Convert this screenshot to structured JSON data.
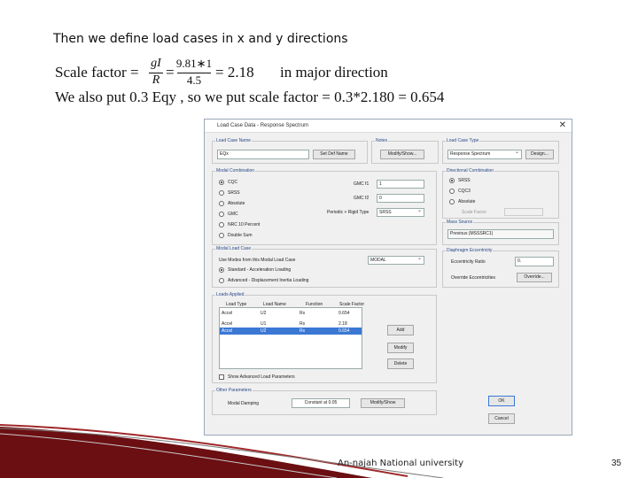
{
  "heading": "Then we define load cases in x and y directions",
  "equation1": {
    "lhs": "Scale factor =",
    "frac1_num": "gI",
    "frac1_den": "R",
    "eq_sign": "=",
    "frac2_num": "9.81∗1",
    "frac2_den": "4.5",
    "result": "= 2.18",
    "note": "in major direction"
  },
  "equation2": "We also put 0.3 Eqy , so we put scale factor = 0.3*2.180 = 0.654",
  "dialog": {
    "title": "Load Case Data - Response Spectrum",
    "close": "✕",
    "load_case_name_group": "Load Case Name",
    "load_case_name": "EQx",
    "set_def_name": "Set Def Name",
    "notes_group": "Notes",
    "modify_show": "Modify/Show...",
    "load_case_type_group": "Load Case Type",
    "load_case_type": "Response Spectrum",
    "design": "Design...",
    "modal_combination_group": "Modal Combination",
    "modal_options": [
      "CQC",
      "SRSS",
      "Absolute",
      "GMC",
      "NRC 10 Percent",
      "Double Sum"
    ],
    "gmc_f1_label": "GMC f1",
    "gmc_f1": "1",
    "gmc_f2_label": "GMC f2",
    "gmc_f2": "0",
    "periodic_rigid_label": "Periodic + Rigid Type",
    "periodic_rigid": "SRSS",
    "directional_combination_group": "Directional Combination",
    "directional_options": [
      "SRSS",
      "CQC3",
      "Absolute"
    ],
    "scale_factor_label": "Scale Factor",
    "mass_source_group": "Mass Source",
    "mass_source": "Previous (MSSSRC1)",
    "modal_load_case_group": "Modal Load Case",
    "use_modes_label": "Use Modes from this Modal Load Case",
    "modal_case": "MODAL",
    "loading_options": [
      "Standard - Acceleration Loading",
      "Advanced - Displacement Inertia Loading"
    ],
    "diaphragm_group": "Diaphragm Eccentricity",
    "eccentricity_ratio_label": "Eccentricity Ratio",
    "eccentricity_ratio": "0.",
    "override_label": "Override Eccentricities",
    "override_button": "Override...",
    "loads_applied_group": "Loads Applied",
    "table_headers": [
      "Load Type",
      "Load Name",
      "Function",
      "Scale Factor"
    ],
    "table_edit_row": [
      "Accel",
      "U2",
      "Rs",
      "0.654"
    ],
    "table_rows": [
      [
        "Accel",
        "U1",
        "Rs",
        "2.18"
      ],
      [
        "Accel",
        "U2",
        "Rs",
        "0.654"
      ]
    ],
    "add": "Add",
    "modify": "Modify",
    "delete": "Delete",
    "show_advanced": "Show Advanced Load Parameters",
    "other_parameters_group": "Other Parameters",
    "modal_damping_label": "Modal Damping",
    "modal_damping": "Constant at 0.05",
    "modify_show2": "Modify/Show",
    "ok": "OK",
    "cancel": "Cancel"
  },
  "footer": "An-najah National university",
  "page_number": "35",
  "colors": {
    "accent_dark": "#6b0f12",
    "accent_mid": "#a0282a",
    "selection": "#3a78d4"
  }
}
